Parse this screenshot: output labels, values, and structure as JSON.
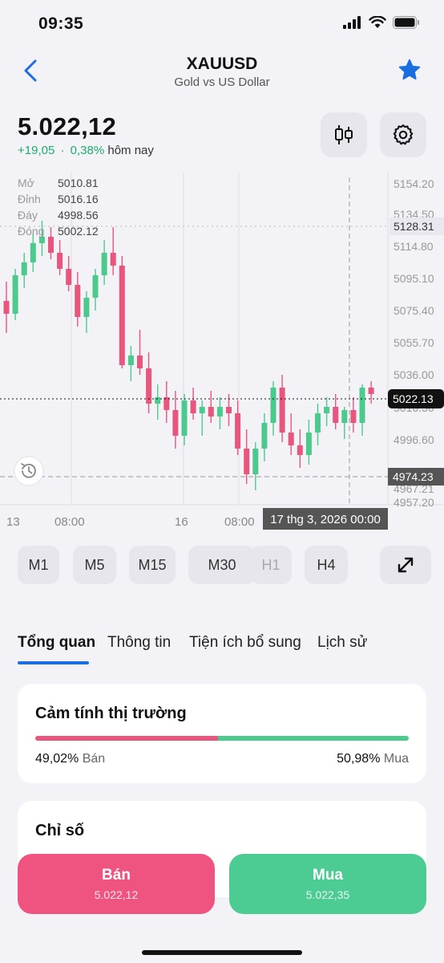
{
  "status": {
    "time": "09:35"
  },
  "nav": {
    "title": "XAUUSD",
    "subtitle": "Gold vs US Dollar"
  },
  "price": {
    "current": "5.022,12",
    "change": "+19,05",
    "change_pct": "0,38%",
    "sep": "·",
    "today": "hôm nay"
  },
  "ohlc": [
    {
      "label": "Mở",
      "value": "5010.81"
    },
    {
      "label": "Đỉnh",
      "value": "5016.16"
    },
    {
      "label": "Đáy",
      "value": "4998.56"
    },
    {
      "label": "Đóng",
      "value": "5002.12"
    }
  ],
  "chart_data": {
    "type": "candlestick",
    "y_ticks": [
      "5154.20",
      "5134.50",
      "5114.80",
      "5095.10",
      "5075.40",
      "5055.70",
      "5036.00",
      "5016.30",
      "4996.60",
      "4967.21",
      "4957.20"
    ],
    "x_ticks": [
      "13",
      "08:00",
      "16",
      "08:00"
    ],
    "current_price_label": "5022.13",
    "crosshair_label": "4974.23",
    "high_marker": "5128.31",
    "crosshair_time": "17 thg 3, 2026 00:00",
    "up_color": "#4cc98c",
    "down_color": "#e8557d",
    "candles": [
      {
        "o": 5080,
        "h": 5092,
        "l": 5060,
        "c": 5072
      },
      {
        "o": 5072,
        "h": 5100,
        "l": 5068,
        "c": 5096
      },
      {
        "o": 5096,
        "h": 5110,
        "l": 5088,
        "c": 5104
      },
      {
        "o": 5104,
        "h": 5122,
        "l": 5098,
        "c": 5116
      },
      {
        "o": 5116,
        "h": 5130,
        "l": 5108,
        "c": 5120
      },
      {
        "o": 5120,
        "h": 5126,
        "l": 5106,
        "c": 5110
      },
      {
        "o": 5110,
        "h": 5118,
        "l": 5096,
        "c": 5100
      },
      {
        "o": 5100,
        "h": 5108,
        "l": 5086,
        "c": 5090
      },
      {
        "o": 5090,
        "h": 5098,
        "l": 5064,
        "c": 5070
      },
      {
        "o": 5070,
        "h": 5086,
        "l": 5060,
        "c": 5082
      },
      {
        "o": 5082,
        "h": 5100,
        "l": 5074,
        "c": 5096
      },
      {
        "o": 5096,
        "h": 5118,
        "l": 5090,
        "c": 5110
      },
      {
        "o": 5110,
        "h": 5126,
        "l": 5096,
        "c": 5102
      },
      {
        "o": 5102,
        "h": 5108,
        "l": 5038,
        "c": 5040
      },
      {
        "o": 5040,
        "h": 5052,
        "l": 5030,
        "c": 5046
      },
      {
        "o": 5046,
        "h": 5062,
        "l": 5034,
        "c": 5038
      },
      {
        "o": 5038,
        "h": 5048,
        "l": 5010,
        "c": 5016
      },
      {
        "o": 5016,
        "h": 5028,
        "l": 5006,
        "c": 5020
      },
      {
        "o": 5020,
        "h": 5030,
        "l": 5004,
        "c": 5012
      },
      {
        "o": 5012,
        "h": 5024,
        "l": 4988,
        "c": 4996
      },
      {
        "o": 4996,
        "h": 5022,
        "l": 4990,
        "c": 5018
      },
      {
        "o": 5018,
        "h": 5026,
        "l": 5006,
        "c": 5010
      },
      {
        "o": 5010,
        "h": 5018,
        "l": 4996,
        "c": 5014
      },
      {
        "o": 5014,
        "h": 5024,
        "l": 5004,
        "c": 5008
      },
      {
        "o": 5008,
        "h": 5020,
        "l": 5000,
        "c": 5014
      },
      {
        "o": 5014,
        "h": 5022,
        "l": 5002,
        "c": 5010
      },
      {
        "o": 5010,
        "h": 5018,
        "l": 4984,
        "c": 4988
      },
      {
        "o": 4988,
        "h": 5000,
        "l": 4966,
        "c": 4972
      },
      {
        "o": 4972,
        "h": 4992,
        "l": 4962,
        "c": 4988
      },
      {
        "o": 4988,
        "h": 5010,
        "l": 4980,
        "c": 5004
      },
      {
        "o": 5004,
        "h": 5030,
        "l": 4996,
        "c": 5026
      },
      {
        "o": 5026,
        "h": 5034,
        "l": 4992,
        "c": 4998
      },
      {
        "o": 4998,
        "h": 5010,
        "l": 4984,
        "c": 4990
      },
      {
        "o": 4990,
        "h": 5000,
        "l": 4976,
        "c": 4984
      },
      {
        "o": 4984,
        "h": 5006,
        "l": 4978,
        "c": 4998
      },
      {
        "o": 4998,
        "h": 5016,
        "l": 4990,
        "c": 5010
      },
      {
        "o": 5010,
        "h": 5020,
        "l": 5002,
        "c": 5014
      },
      {
        "o": 5014,
        "h": 5022,
        "l": 5000,
        "c": 5004
      },
      {
        "o": 5004,
        "h": 5014,
        "l": 4994,
        "c": 5012
      },
      {
        "o": 5012,
        "h": 5020,
        "l": 4998,
        "c": 5004
      },
      {
        "o": 5004,
        "h": 5028,
        "l": 4996,
        "c": 5026
      },
      {
        "o": 5026,
        "h": 5030,
        "l": 5016,
        "c": 5022
      }
    ]
  },
  "timeframes": [
    {
      "label": "M1",
      "enabled": true
    },
    {
      "label": "M5",
      "enabled": true
    },
    {
      "label": "M15",
      "enabled": true
    },
    {
      "label": "M30",
      "enabled": true
    },
    {
      "label": "H1",
      "enabled": false
    },
    {
      "label": "H4",
      "enabled": true
    }
  ],
  "tabs": [
    "Tổng quan",
    "Thông tin",
    "Tiện ích bổ sung",
    "Lịch sử"
  ],
  "sentiment": {
    "title": "Cảm tính thị trường",
    "sell_pct": "49,02%",
    "sell_label": "Bán",
    "sell_value": 49.02,
    "buy_pct": "50,98%",
    "buy_label": "Mua",
    "buy_value": 50.98,
    "sell_color": "#e8557d",
    "buy_color": "#4cc98c"
  },
  "indicators": {
    "title": "Chỉ số"
  },
  "trade": {
    "sell_label": "Bán",
    "sell_price": "5.022,12",
    "buy_label": "Mua",
    "buy_price": "5.022,35",
    "sell_color": "#ef5480",
    "buy_color": "#4ccb92"
  }
}
